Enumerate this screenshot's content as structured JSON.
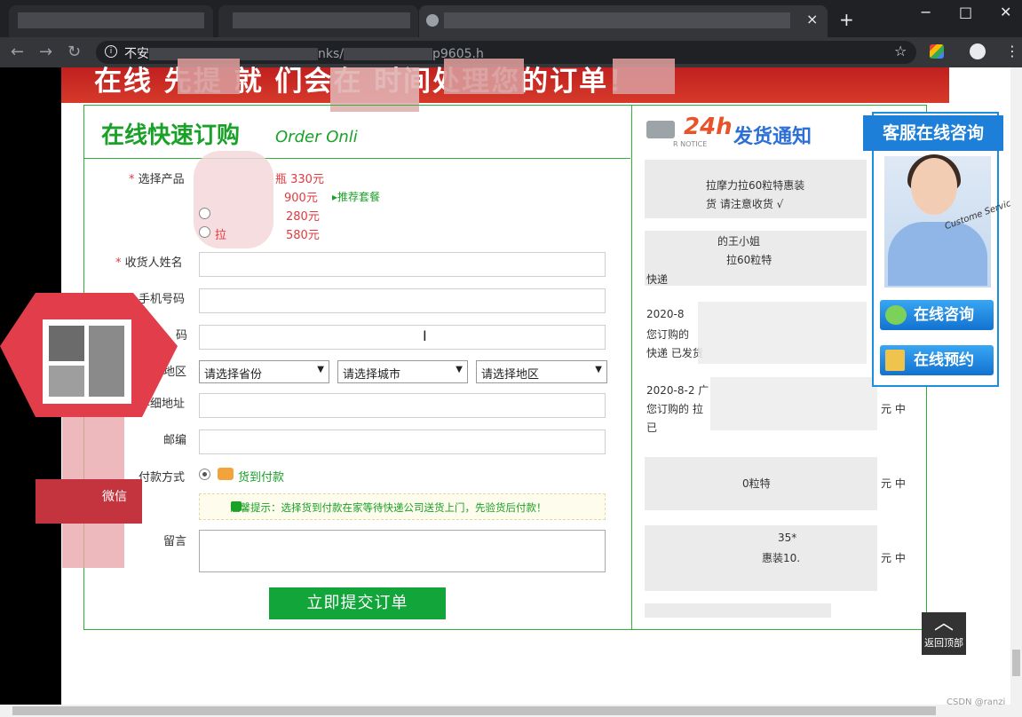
{
  "browser": {
    "url_prefix": "不安",
    "url_mid": "nks/",
    "url_suffix": "p9605.h",
    "new_tab_label": "+",
    "tab_close": "×",
    "win_min": "−",
    "win_max": "□",
    "win_close": "✕"
  },
  "banner": {
    "text": "在线  先提    就     们会在     时间处理您的订单！"
  },
  "order": {
    "title": "在线快速订购",
    "subtitle": "Order Onli",
    "product_label": "选择产品",
    "product_options": [
      "瓶 330元",
      "900元",
      "280元",
      "580元"
    ],
    "recommend": "▸推荐套餐",
    "option_prefix": "拉",
    "name_label": "收货人姓名",
    "phone_label": "手机号码",
    "phone2_label": "码",
    "region_label": "地区",
    "province": "请选择省份",
    "city": "请选择城市",
    "district": "请选择地区",
    "address_label": "详细地址",
    "zip_label": "邮编",
    "payment_label": "付款方式",
    "payment_option": "货到付款",
    "tip": "温馨提示：选择货到付款在家等待快递公司送货上门，先验货后付款！",
    "message_label": "留言",
    "submit": "立即提交订单",
    "required_mark": "*"
  },
  "notice": {
    "title": "发货通知",
    "badge": "24h",
    "sub": "R NOTICE",
    "items": [
      "拉摩力拉60粒特惠装",
      "货 请注意收货 √",
      "的王小姐",
      "拉60粒特",
      "快递",
      "2020-8",
      "您订购的",
      "快递 已发货",
      "2020-8-2 广",
      "您订购的 拉",
      "元 中",
      "已",
      "0粒特",
      "元 中",
      "35*",
      "惠装10.",
      "元 中"
    ]
  },
  "service": {
    "title": "客服在线咨询",
    "script": "Custome Service",
    "consult": "在线咨询",
    "booking": "在线预约"
  },
  "float_left": {
    "wechat": "微信"
  },
  "back_top": {
    "label": "返回顶部",
    "chev": "︿"
  },
  "watermark": "CSDN @ranzi",
  "colors": {
    "accent_green": "#19a128",
    "banner_red": "#c0201f",
    "service_blue": "#1d7fd8"
  }
}
